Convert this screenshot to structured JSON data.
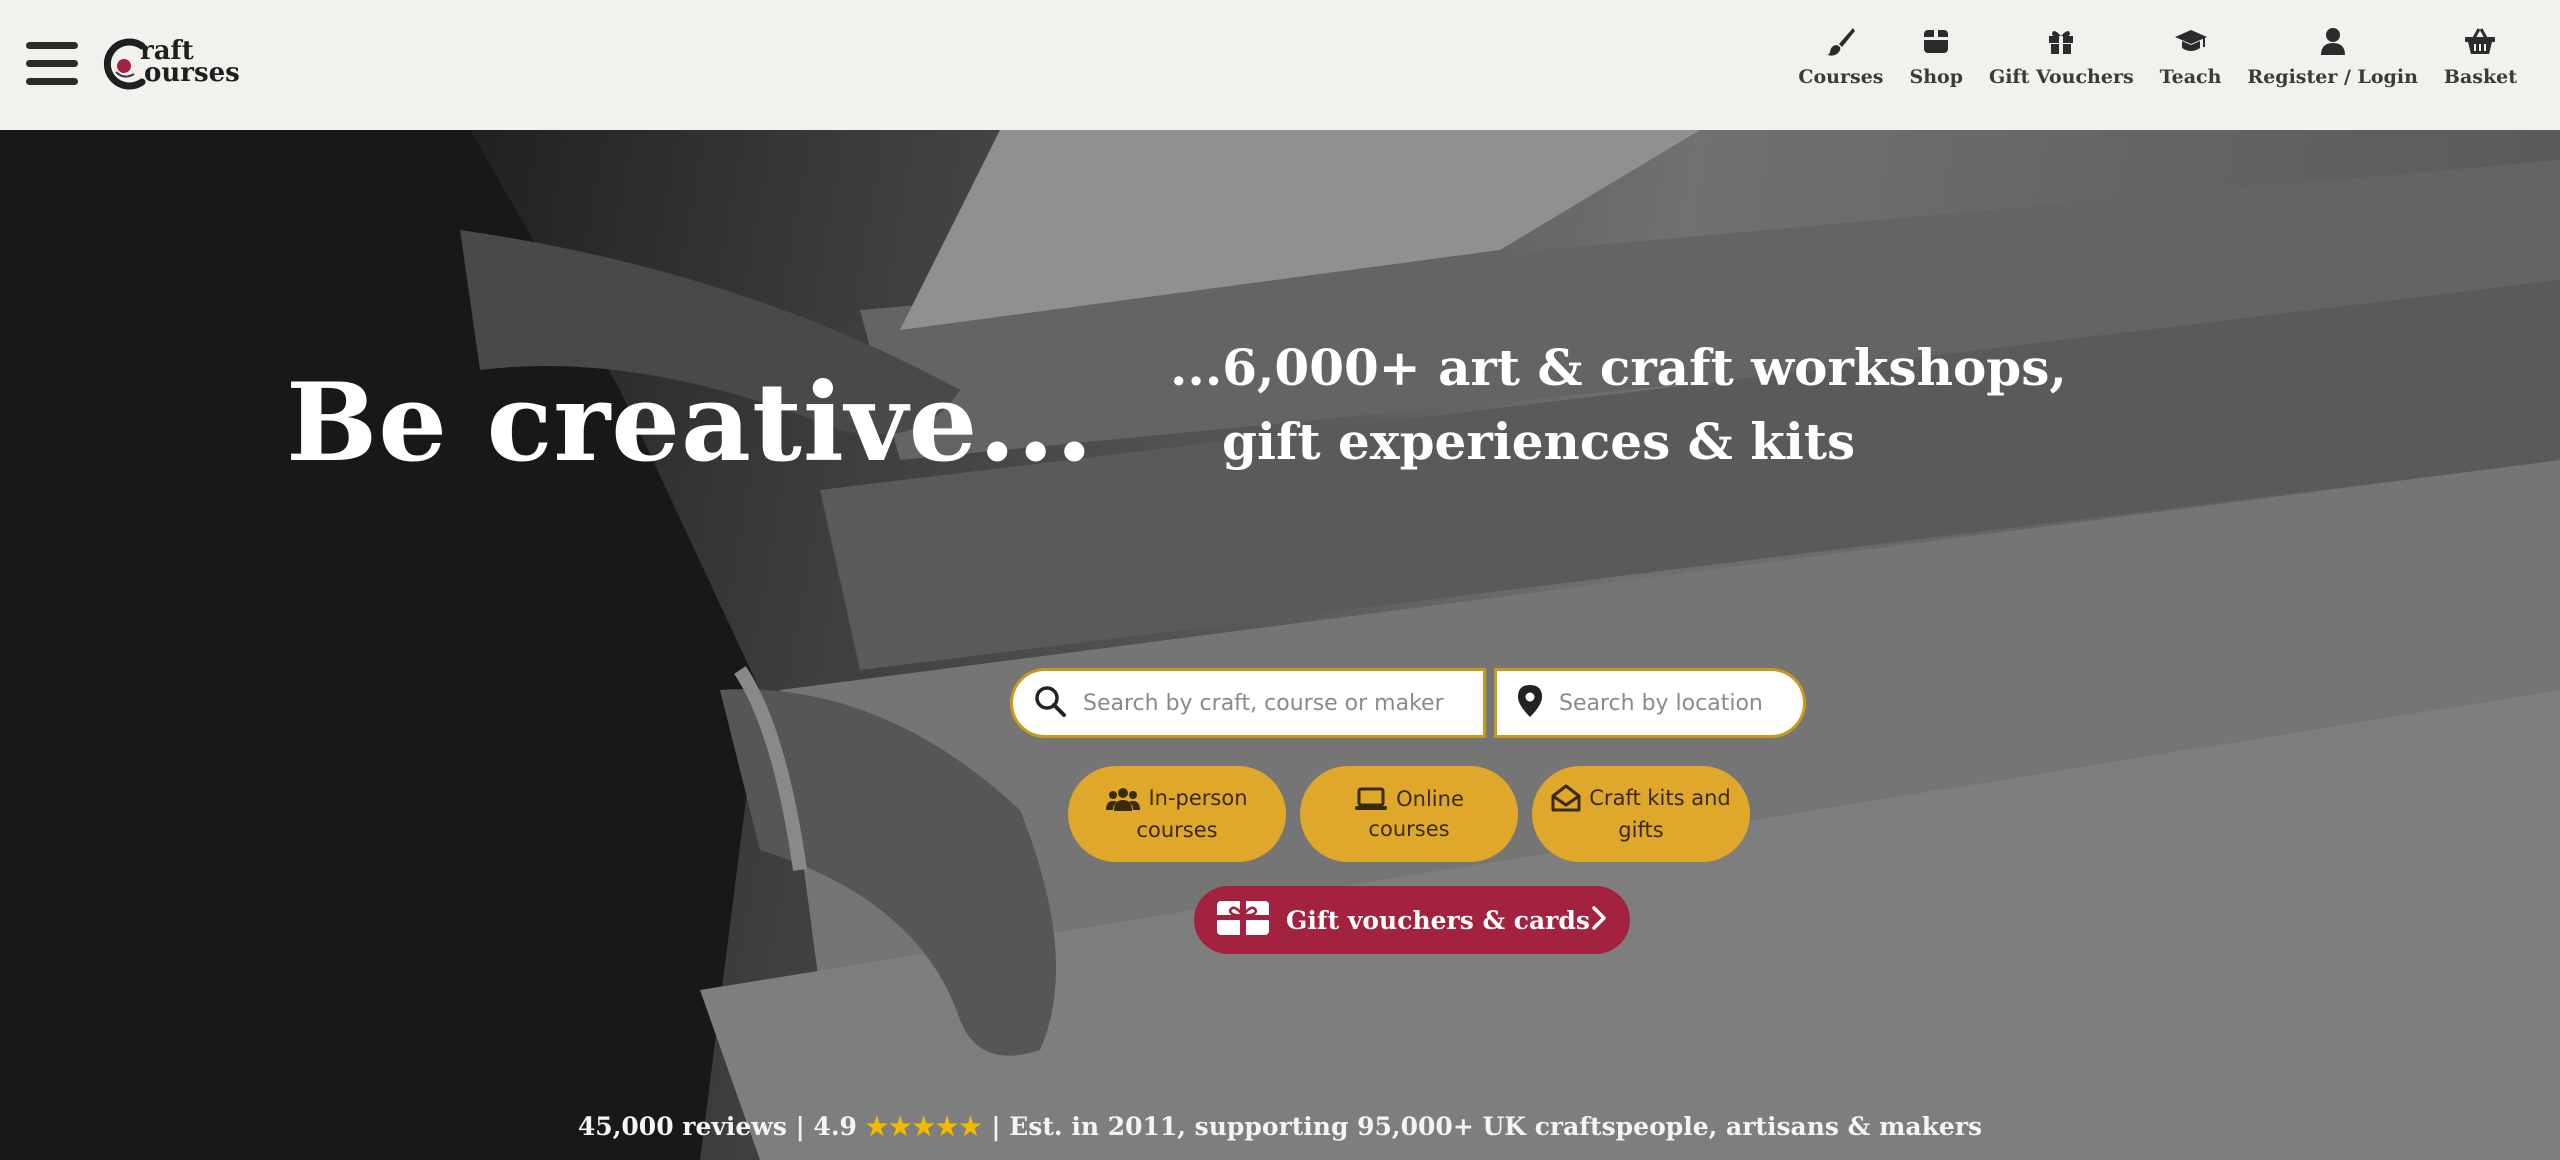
{
  "header": {
    "logo": {
      "line1": "raft",
      "line2": "ourses"
    },
    "nav": [
      {
        "label": "Courses",
        "icon": "paintbrush-icon"
      },
      {
        "label": "Shop",
        "icon": "shop-box-icon"
      },
      {
        "label": "Gift Vouchers",
        "icon": "gift-icon"
      },
      {
        "label": "Teach",
        "icon": "graduation-cap-icon"
      },
      {
        "label": "Register / Login",
        "icon": "user-icon"
      },
      {
        "label": "Basket",
        "icon": "basket-icon"
      }
    ]
  },
  "hero": {
    "headline": "Be creative...",
    "subline1": "...6,000+ art & craft workshops,",
    "subline2": "gift experiences & kits",
    "search": {
      "craft_placeholder": "Search by craft, course or maker",
      "location_placeholder": "Search by location"
    },
    "pills": [
      {
        "line1": "In-person",
        "line2": "courses",
        "icon": "people-icon"
      },
      {
        "line1": "Online",
        "line2": "courses",
        "icon": "laptop-icon"
      },
      {
        "line1": "Craft kits and",
        "line2": "gifts",
        "icon": "envelope-open-icon"
      }
    ],
    "gift_button": "Gift vouchers & cards",
    "reviews": {
      "count": "45,000 reviews",
      "rating": "4.9",
      "tagline": "Est. in 2011, supporting 95,000+ UK craftspeople, artisans & makers"
    }
  },
  "colors": {
    "header_bg": "#f2f1ed",
    "pill": "#e0a82a",
    "gift_button": "#a3223f",
    "star": "#f2b900"
  }
}
